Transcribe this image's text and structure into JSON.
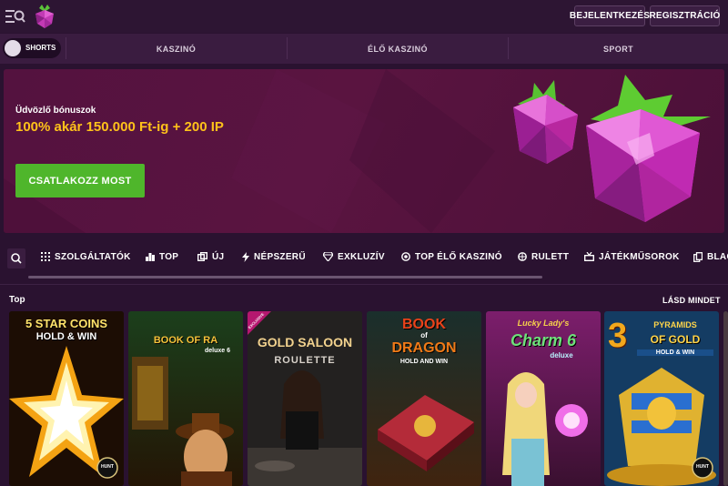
{
  "header": {
    "login_label": "BEJELENTKEZÉS",
    "register_label": "REGISZTRÁCIÓ"
  },
  "nav": {
    "shorts_label": "SHORTS",
    "items": [
      "KASZINÓ",
      "ÉLŐ KASZINÓ",
      "SPORT"
    ]
  },
  "banner": {
    "subtitle": "Üdvözlő bónuszok",
    "headline": "100% akár 150.000 Ft-ig + 200 IP",
    "cta_label": "CSATLAKOZZ MOST"
  },
  "categories": [
    "SZOLGÁLTATÓK",
    "TOP",
    "ÚJ",
    "NÉPSZERŰ",
    "EXKLUZÍV",
    "TOP ÉLŐ KASZINÓ",
    "RULETT",
    "JÁTÉKMŰSOROK",
    "BLAC"
  ],
  "section": {
    "title": "Top",
    "see_all_label": "LÁSD MINDET"
  },
  "games": [
    {
      "line1": "5 STAR COINS",
      "line2": "HOLD & WIN",
      "badge": "HUNT"
    },
    {
      "line1": "BOOK OF RA",
      "line2": "deluxe 6"
    },
    {
      "line1": "GOLD SALOON",
      "line2": "ROULETTE",
      "ribbon": "EXCLUSIVE"
    },
    {
      "line1": "BOOK",
      "line2": "of",
      "line3": "DRAGON",
      "line4": "HOLD AND WIN"
    },
    {
      "line1": "Lucky Lady's",
      "line2": "Charm 6",
      "line3": "deluxe"
    },
    {
      "line1": "3",
      "line2": "PYRAMIDS",
      "line3": "OF GOLD",
      "line4": "HOLD & WIN",
      "badge": "HUNT"
    }
  ],
  "colors": {
    "accent_yellow": "#ffc21a",
    "cta_green": "#4fb62b",
    "background": "#2a1230"
  }
}
